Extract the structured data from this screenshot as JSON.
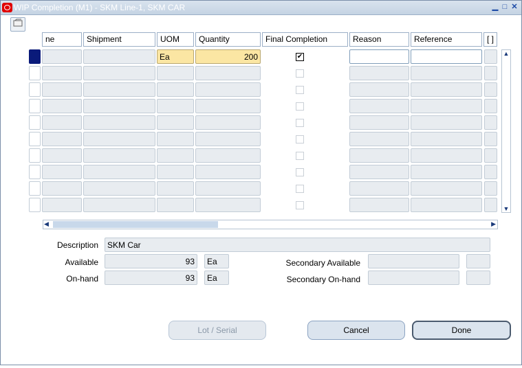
{
  "window": {
    "title": "WIP Completion (M1) - SKM Line-1, SKM CAR",
    "controls": [
      "▁",
      "□",
      "✕"
    ]
  },
  "toolbar": {
    "folder_icon": "folder-tools-icon"
  },
  "columns": {
    "name": "ne",
    "shipment": "Shipment",
    "uom": "UOM",
    "quantity": "Quantity",
    "final": "Final Completion",
    "reason": "Reason",
    "reference": "Reference",
    "dff": "[ ]"
  },
  "row1": {
    "uom": "Ea",
    "quantity": "200",
    "final_checked": true
  },
  "details": {
    "description_label": "Description",
    "description_value": "SKM Car",
    "available_label": "Available",
    "available_value": "93",
    "available_uom": "Ea",
    "onhand_label": "On-hand",
    "onhand_value": "93",
    "onhand_uom": "Ea",
    "sec_available_label": "Secondary Available",
    "sec_onhand_label": "Secondary On-hand"
  },
  "buttons": {
    "lot": "Lot / Serial",
    "cancel": "Cancel",
    "done": "Done"
  },
  "colors": {
    "selected_row": "#0a1a7a",
    "current_field": "#fbe6a3"
  }
}
